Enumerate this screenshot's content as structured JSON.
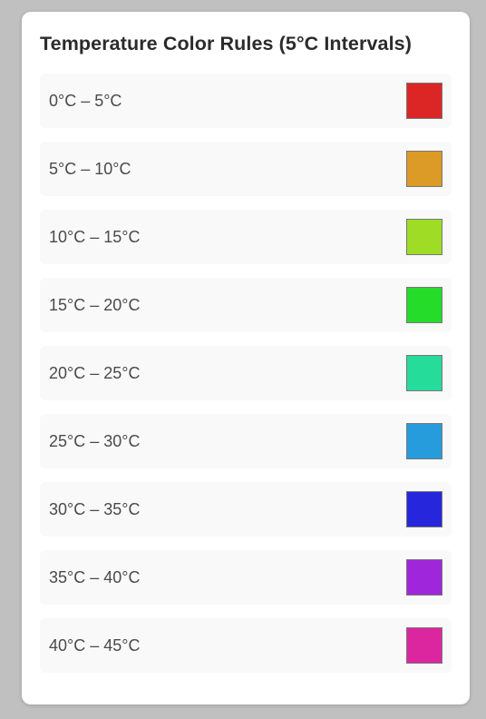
{
  "panel": {
    "title": "Temperature Color Rules (5°C Intervals)"
  },
  "rules": [
    {
      "label": "0°C – 5°C",
      "color": "#dc2626"
    },
    {
      "label": "5°C – 10°C",
      "color": "#dc9a26"
    },
    {
      "label": "10°C – 15°C",
      "color": "#9edc26"
    },
    {
      "label": "15°C – 20°C",
      "color": "#26dc2a"
    },
    {
      "label": "20°C – 25°C",
      "color": "#26dc9a"
    },
    {
      "label": "25°C – 30°C",
      "color": "#269cdc"
    },
    {
      "label": "30°C – 35°C",
      "color": "#2626dc"
    },
    {
      "label": "35°C – 40°C",
      "color": "#a026dc"
    },
    {
      "label": "40°C – 45°C",
      "color": "#dc26a0"
    }
  ]
}
